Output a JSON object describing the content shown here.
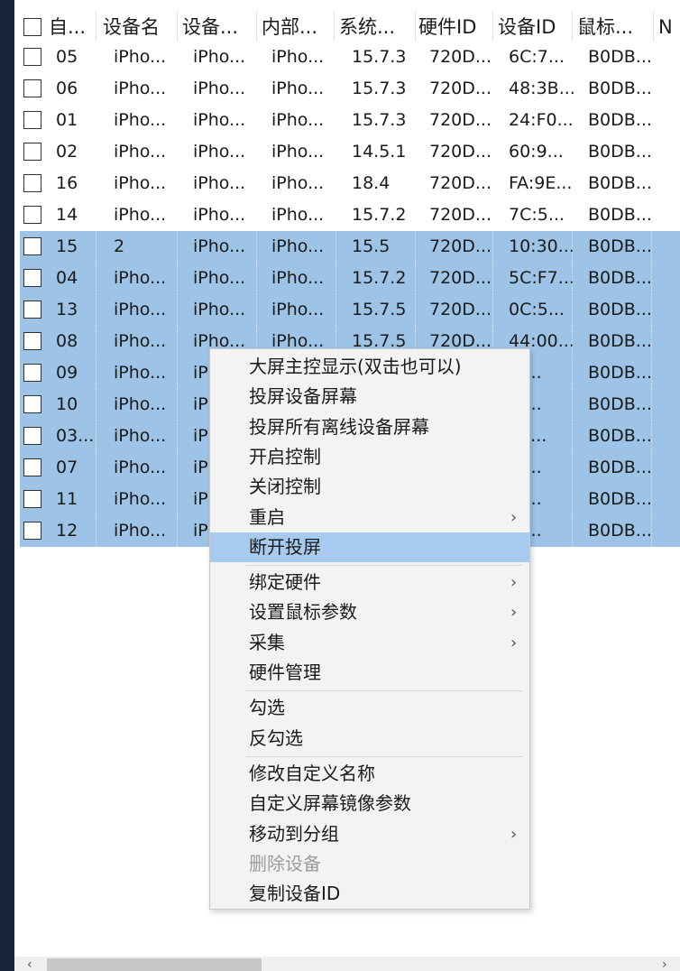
{
  "columns": [
    "自...",
    "设备名",
    "设备...",
    "内部...",
    "系统...",
    "硬件ID",
    "设备ID",
    "鼠标...",
    "N"
  ],
  "rows": [
    {
      "id": "05",
      "name": "iPho...",
      "c3": "iPho...",
      "c4": "iPho...",
      "os": "15.7.3",
      "hw": "720D...",
      "dev": "6C:7...",
      "mouse": "B0DB...",
      "selected": false
    },
    {
      "id": "06",
      "name": "iPho...",
      "c3": "iPho...",
      "c4": "iPho...",
      "os": "15.7.3",
      "hw": "720D...",
      "dev": "48:3B...",
      "mouse": "B0DB...",
      "selected": false
    },
    {
      "id": "01",
      "name": "iPho...",
      "c3": "iPho...",
      "c4": "iPho...",
      "os": "15.7.3",
      "hw": "720D...",
      "dev": "24:F0...",
      "mouse": "B0DB...",
      "selected": false
    },
    {
      "id": "02",
      "name": "iPho...",
      "c3": "iPho...",
      "c4": "iPho...",
      "os": "14.5.1",
      "hw": "720D...",
      "dev": "60:9...",
      "mouse": "B0DB...",
      "selected": false
    },
    {
      "id": "16",
      "name": "iPho...",
      "c3": "iPho...",
      "c4": "iPho...",
      "os": "18.4",
      "hw": "720D...",
      "dev": "FA:9E...",
      "mouse": "B0DB...",
      "selected": false
    },
    {
      "id": "14",
      "name": "iPho...",
      "c3": "iPho...",
      "c4": "iPho...",
      "os": "15.7.2",
      "hw": "720D...",
      "dev": "7C:5...",
      "mouse": "B0DB...",
      "selected": false
    },
    {
      "id": "15",
      "name": "2",
      "c3": "iPho...",
      "c4": "iPho...",
      "os": "15.5",
      "hw": "720D...",
      "dev": "10:30...",
      "mouse": "B0DB...",
      "selected": true
    },
    {
      "id": "04",
      "name": "iPho...",
      "c3": "iPho...",
      "c4": "iPho...",
      "os": "15.7.2",
      "hw": "720D...",
      "dev": "5C:F7...",
      "mouse": "B0DB...",
      "selected": true
    },
    {
      "id": "13",
      "name": "iPho...",
      "c3": "iPho...",
      "c4": "iPho...",
      "os": "15.7.5",
      "hw": "720D...",
      "dev": "0C:5...",
      "mouse": "B0DB...",
      "selected": true
    },
    {
      "id": "08",
      "name": "iPho...",
      "c3": "iPho...",
      "c4": "iPho...",
      "os": "15.7.5",
      "hw": "720D...",
      "dev": "44:00...",
      "mouse": "B0DB...",
      "selected": true
    },
    {
      "id": "09",
      "name": "iPho...",
      "c3": "iP",
      "c4": "",
      "os": "",
      "hw": "",
      "dev": ":5...",
      "mouse": "B0DB...",
      "selected": true
    },
    {
      "id": "10",
      "name": "iPho...",
      "c3": "iP",
      "c4": "",
      "os": "",
      "hw": "",
      "dev": ":8...",
      "mouse": "B0DB...",
      "selected": true
    },
    {
      "id": "03...",
      "name": "iPho...",
      "c3": "iP",
      "c4": "",
      "os": "",
      "hw": "",
      "dev": "00...",
      "mouse": "B0DB...",
      "selected": true
    },
    {
      "id": "07",
      "name": "iPho...",
      "c3": "iP",
      "c4": "",
      "os": "",
      "hw": "",
      "dev": ":5...",
      "mouse": "B0DB...",
      "selected": true
    },
    {
      "id": "11",
      "name": "iPho...",
      "c3": "iP",
      "c4": "",
      "os": "",
      "hw": "",
      "dev": ":5...",
      "mouse": "B0DB...",
      "selected": true
    },
    {
      "id": "12",
      "name": "iPho...",
      "c3": "iP",
      "c4": "",
      "os": "",
      "hw": "",
      "dev": ":5...",
      "mouse": "B0DB...",
      "selected": true
    }
  ],
  "context_menu": {
    "items": [
      {
        "label": "大屏主控显示(双击也可以)",
        "submenu": false,
        "disabled": false,
        "highlighted": false
      },
      {
        "label": "投屏设备屏幕",
        "submenu": false,
        "disabled": false,
        "highlighted": false
      },
      {
        "label": "投屏所有离线设备屏幕",
        "submenu": false,
        "disabled": false,
        "highlighted": false
      },
      {
        "label": "开启控制",
        "submenu": false,
        "disabled": false,
        "highlighted": false
      },
      {
        "label": "关闭控制",
        "submenu": false,
        "disabled": false,
        "highlighted": false
      },
      {
        "label": "重启",
        "submenu": true,
        "disabled": false,
        "highlighted": false
      },
      {
        "label": "断开投屏",
        "submenu": false,
        "disabled": false,
        "highlighted": true
      },
      {
        "separator": true
      },
      {
        "label": "绑定硬件",
        "submenu": true,
        "disabled": false,
        "highlighted": false
      },
      {
        "label": "设置鼠标参数",
        "submenu": true,
        "disabled": false,
        "highlighted": false
      },
      {
        "label": "采集",
        "submenu": true,
        "disabled": false,
        "highlighted": false
      },
      {
        "label": "硬件管理",
        "submenu": false,
        "disabled": false,
        "highlighted": false
      },
      {
        "separator": true
      },
      {
        "label": "勾选",
        "submenu": false,
        "disabled": false,
        "highlighted": false
      },
      {
        "label": "反勾选",
        "submenu": false,
        "disabled": false,
        "highlighted": false
      },
      {
        "separator": true
      },
      {
        "label": "修改自定义名称",
        "submenu": false,
        "disabled": false,
        "highlighted": false
      },
      {
        "label": "自定义屏幕镜像参数",
        "submenu": false,
        "disabled": false,
        "highlighted": false
      },
      {
        "label": "移动到分组",
        "submenu": true,
        "disabled": false,
        "highlighted": false
      },
      {
        "label": "删除设备",
        "submenu": false,
        "disabled": true,
        "highlighted": false
      },
      {
        "label": "复制设备ID",
        "submenu": false,
        "disabled": false,
        "highlighted": false
      }
    ],
    "submenu_arrow": "›"
  },
  "scrollbar": {
    "left_arrow": "‹",
    "right_arrow": "›"
  },
  "colors": {
    "selection": "#9dc4e7",
    "menu_highlight": "#a7cbef",
    "menu_bg": "#f3f3f3",
    "backdrop": "#18253a"
  }
}
